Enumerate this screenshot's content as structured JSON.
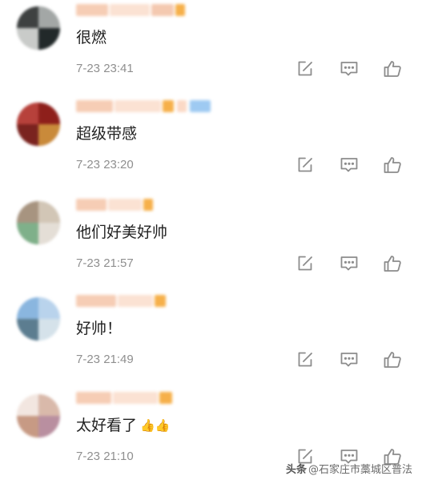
{
  "comments": [
    {
      "text": "很燃",
      "time": "7-23 23:41",
      "thumbs": ""
    },
    {
      "text": "超级带感",
      "time": "7-23 23:20",
      "thumbs": ""
    },
    {
      "text": "他们好美好帅",
      "time": "7-23 21:57",
      "thumbs": ""
    },
    {
      "text": "好帅！",
      "time": "7-23 21:49",
      "thumbs": ""
    },
    {
      "text": "太好看了",
      "time": "7-23 21:10",
      "thumbs": "👍👍"
    }
  ],
  "icons": {
    "repost": "repost-icon",
    "comment": "comment-icon",
    "like": "thumbs-up-icon"
  },
  "colors": {
    "text": "#222222",
    "timestamp": "#8f8f8f",
    "icon": "#8c8c8c",
    "background": "#ffffff"
  },
  "watermark": {
    "platform": "头条",
    "account": "@石家庄市藁城区普法"
  }
}
